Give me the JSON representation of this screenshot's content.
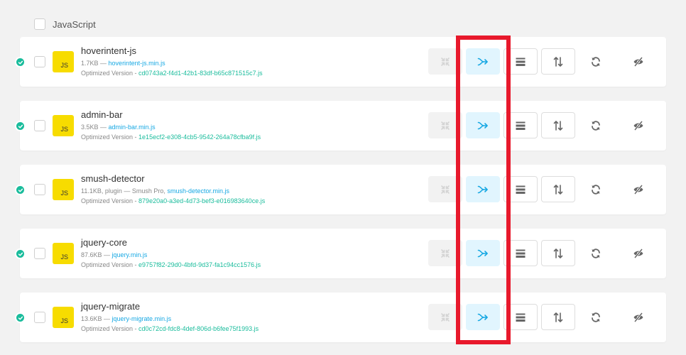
{
  "section": {
    "title": "JavaScript"
  },
  "rows": [
    {
      "name": "hoverintent-js",
      "size": "1.7KB —",
      "extra": "",
      "file": "hoverintent-js.min.js",
      "opt_label": "Optimized Version -",
      "opt_hash": "cd0743a2-f4d1-42b1-83df-b65c871515c7.js"
    },
    {
      "name": "admin-bar",
      "size": "3.5KB —",
      "extra": "",
      "file": "admin-bar.min.js",
      "opt_label": "Optimized Version -",
      "opt_hash": "1e15ecf2-e308-4cb5-9542-264a78cfba9f.js"
    },
    {
      "name": "smush-detector",
      "size": "11.1KB, plugin —",
      "extra": "Smush Pro,",
      "file": "smush-detector.min.js",
      "opt_label": "Optimized Version -",
      "opt_hash": "879e20a0-a3ed-4d73-bef3-e016983640ce.js"
    },
    {
      "name": "jquery-core",
      "size": "87.6KB —",
      "extra": "",
      "file": "jquery.min.js",
      "opt_label": "Optimized Version -",
      "opt_hash": "e9757f82-29d0-4bfd-9d37-fa1c94cc1576.js"
    },
    {
      "name": "jquery-migrate",
      "size": "13.6KB —",
      "extra": "",
      "file": "jquery-migrate.min.js",
      "opt_label": "Optimized Version -",
      "opt_hash": "cd0c72cd-fdc8-4def-806d-b6fee75f1993.js"
    }
  ],
  "icons": {
    "js_badge": "JS",
    "status": "check-icon",
    "buttons": [
      "compress-icon",
      "combine-icon",
      "footer-icon",
      "defer-icon",
      "inline-icon",
      "exclude-icon"
    ]
  },
  "colors": {
    "accent": "#17a8e3",
    "success": "#1abc9c",
    "js_yellow": "#f7dc00",
    "highlight": "#e8192c"
  }
}
